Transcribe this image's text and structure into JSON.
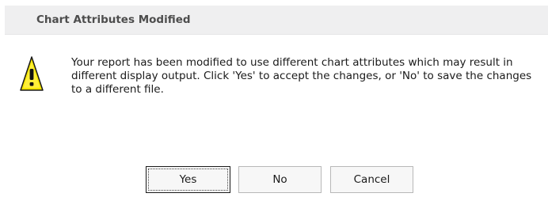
{
  "dialog": {
    "title": "Chart Attributes Modified",
    "icon": "warning-icon",
    "message": "Your report has been modified to use different chart attributes which may result in different display output. Click 'Yes' to accept the changes, or 'No' to save the changes to a different file.",
    "buttons": {
      "yes": "Yes",
      "no": "No",
      "cancel": "Cancel"
    },
    "colors": {
      "titlebar_bg": "#efeff0",
      "warning_fill": "#f5e500",
      "warning_outline": "#1a1a1a"
    }
  }
}
